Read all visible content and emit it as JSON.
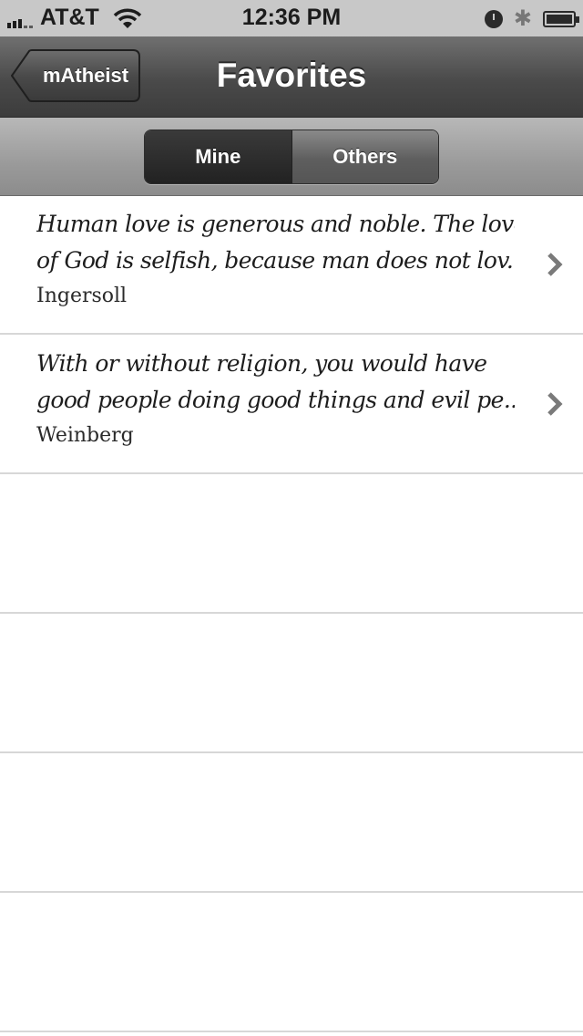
{
  "status_bar": {
    "carrier": "AT&T",
    "time": "12:36 PM",
    "icons": [
      "signal-icon",
      "wifi-icon",
      "alarm-icon",
      "bluetooth-icon",
      "battery-charging-icon"
    ]
  },
  "nav": {
    "back_label": "mAtheist",
    "title": "Favorites"
  },
  "segments": {
    "options": [
      "Mine",
      "Others"
    ],
    "selected": "Mine"
  },
  "favorites": [
    {
      "quote_line1": "Human love is generous and noble. The love",
      "quote_line2": "of God is selfish, because man does not lov...",
      "author": "Ingersoll"
    },
    {
      "quote_line1": "With or without religion, you would have",
      "quote_line2": "good people doing good things and evil pe...",
      "author": "Weinberg"
    }
  ],
  "colors": {
    "nav_gradient_top": "#707070",
    "nav_gradient_bottom": "#3c3c3c",
    "separator": "#d7d7d7",
    "text": "#1d1d1d"
  }
}
